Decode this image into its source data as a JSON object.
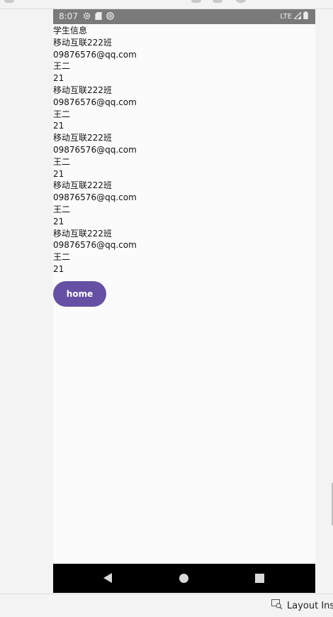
{
  "status_bar": {
    "time": "8:07",
    "network": "LTE",
    "left_icons": [
      "gear-icon",
      "sd-card-icon",
      "sync-icon"
    ],
    "right_icons": [
      "signal-icon",
      "battery-icon"
    ]
  },
  "app": {
    "header": "学生信息",
    "records": [
      {
        "class_name": "移动互联222班",
        "email": "09876576@qq.com",
        "name": "王二",
        "age": "21"
      },
      {
        "class_name": "移动互联222班",
        "email": "09876576@qq.com",
        "name": "王二",
        "age": "21"
      },
      {
        "class_name": "移动互联222班",
        "email": "09876576@qq.com",
        "name": "王二",
        "age": "21"
      },
      {
        "class_name": "移动互联222班",
        "email": "09876576@qq.com",
        "name": "王二",
        "age": "21"
      },
      {
        "class_name": "移动互联222班",
        "email": "09876576@qq.com",
        "name": "王二",
        "age": "21"
      }
    ],
    "home_button_label": "home",
    "accent_color": "#6650a4"
  },
  "nav_bar": {
    "icons": [
      "back-icon",
      "home-icon",
      "recents-icon"
    ]
  },
  "ide": {
    "bottom_tab_label": "Layout Ins"
  }
}
